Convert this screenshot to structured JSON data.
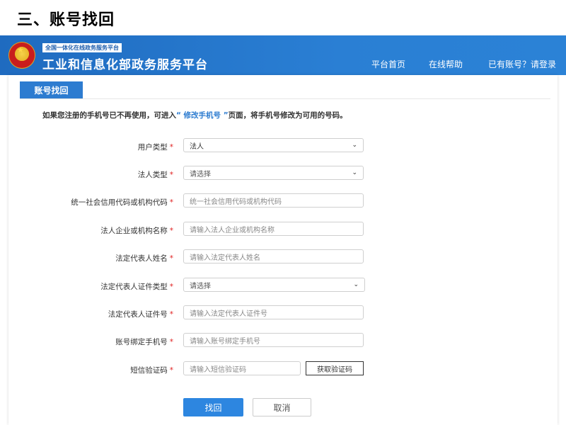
{
  "slide_title": "三、账号找回",
  "header": {
    "subtitle": "全国一体化在线政务服务平台",
    "title": "工业和信息化部政务服务平台",
    "nav": {
      "home": "平台首页",
      "help": "在线帮助",
      "login": "已有账号？请登录"
    }
  },
  "panel": {
    "tab_label": "账号找回",
    "notice_before": "如果您注册的手机号已不再使用，可进入",
    "notice_link": "“ 修改手机号 ”",
    "notice_after": "页面，将手机号修改为可用的号码。"
  },
  "form": {
    "user_type": {
      "label": "用户类型",
      "req": "*",
      "value": "法人"
    },
    "legal_type": {
      "label": "法人类型",
      "req": "*",
      "value": "请选择"
    },
    "credit_code": {
      "label": "统一社会信用代码或机构代码",
      "req": "*",
      "placeholder": "统一社会信用代码或机构代码"
    },
    "org_name": {
      "label": "法人企业或机构名称",
      "req": "*",
      "placeholder": "请输入法人企业或机构名称"
    },
    "rep_name": {
      "label": "法定代表人姓名",
      "req": "*",
      "placeholder": "请输入法定代表人姓名"
    },
    "rep_id_type": {
      "label": "法定代表人证件类型",
      "req": "*",
      "value": "请选择"
    },
    "rep_id_no": {
      "label": "法定代表人证件号",
      "req": "*",
      "placeholder": "请输入法定代表人证件号"
    },
    "phone": {
      "label": "账号绑定手机号",
      "req": "*",
      "placeholder": "请输入账号绑定手机号"
    },
    "sms_code": {
      "label": "短信验证码",
      "req": "*",
      "placeholder": "请输入短信验证码",
      "button": "获取验证码"
    }
  },
  "actions": {
    "submit": "找回",
    "cancel": "取消"
  }
}
